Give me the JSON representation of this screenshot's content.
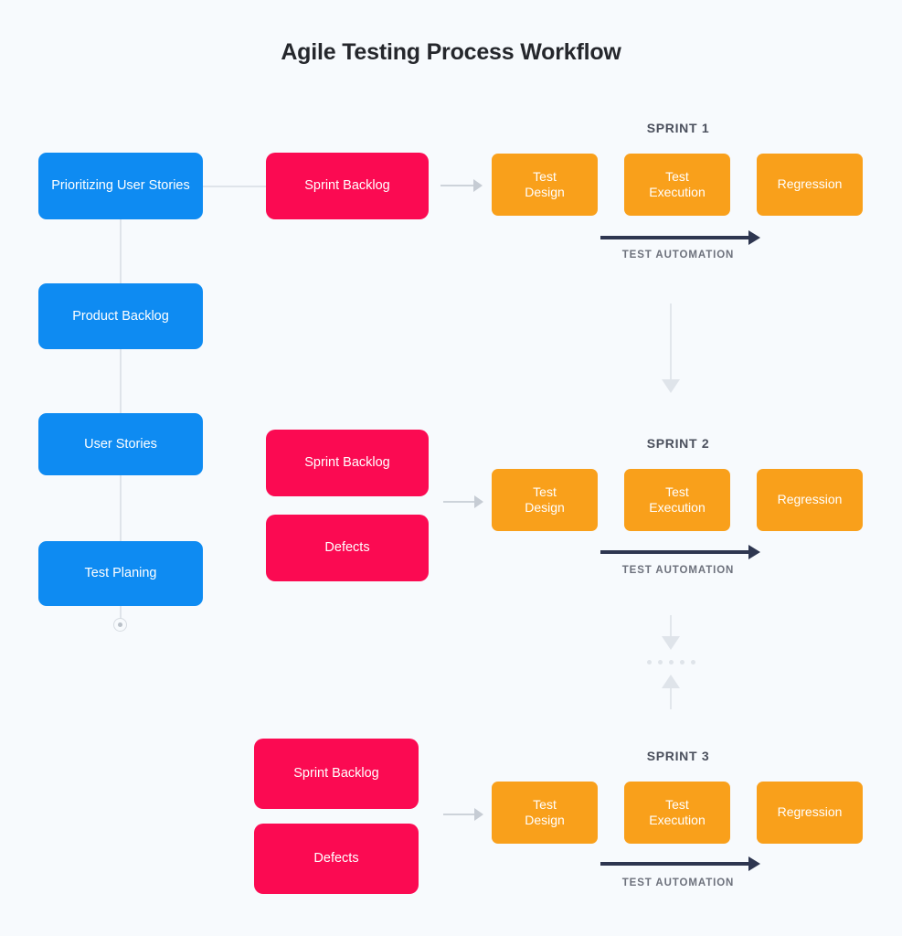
{
  "title": "Agile Testing Process Workflow",
  "colors": {
    "background": "#f7fafd",
    "blue": "#0e8bf2",
    "pink": "#fb0a52",
    "orange": "#f9a01b",
    "navy": "#2e3650",
    "connector_grey": "#dfe4ea",
    "title_text": "#25272c"
  },
  "planning_column": {
    "nodes": [
      {
        "label": "Prioritizing User Stories"
      },
      {
        "label": "Product Backlog"
      },
      {
        "label": "User Stories"
      },
      {
        "label": "Test Planing"
      }
    ]
  },
  "sprints": [
    {
      "label": "SPRINT 1",
      "inputs": [
        {
          "label": "Sprint Backlog"
        }
      ],
      "stages": [
        {
          "label": "Test\nDesign"
        },
        {
          "label": "Test\nExecution"
        },
        {
          "label": "Regression"
        }
      ],
      "automation_label": "TEST AUTOMATION"
    },
    {
      "label": "SPRINT 2",
      "inputs": [
        {
          "label": "Sprint Backlog"
        },
        {
          "label": "Defects"
        }
      ],
      "stages": [
        {
          "label": "Test\nDesign"
        },
        {
          "label": "Test\nExecution"
        },
        {
          "label": "Regression"
        }
      ],
      "automation_label": "TEST AUTOMATION"
    },
    {
      "label": "SPRINT 3",
      "inputs": [
        {
          "label": "Sprint Backlog"
        },
        {
          "label": "Defects"
        }
      ],
      "stages": [
        {
          "label": "Test\nDesign"
        },
        {
          "label": "Test\nExecution"
        },
        {
          "label": "Regression"
        }
      ],
      "automation_label": "TEST AUTOMATION"
    }
  ]
}
